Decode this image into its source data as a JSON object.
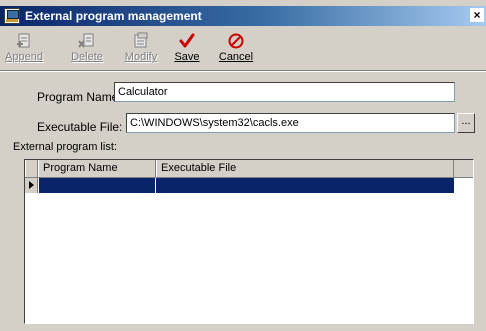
{
  "window": {
    "title": "External program management",
    "close_label": "×"
  },
  "toolbar": {
    "append_label": "Append",
    "delete_label": "Delete",
    "modify_label": "Modify",
    "save_label": "Save",
    "cancel_label": "Cancel"
  },
  "form": {
    "program_name_label": "Program Name:",
    "program_name_value": "Calculator",
    "executable_file_label": "Executable File:",
    "executable_file_value": "C:\\WINDOWS\\system32\\cacls.exe",
    "browse_label": "..."
  },
  "list": {
    "label": "External program list:",
    "columns": [
      "Program Name",
      "Executable File"
    ],
    "rows": [
      {
        "program_name": "",
        "executable_file": "",
        "selected": true
      }
    ]
  },
  "colors": {
    "title_bar": "#0a246a",
    "selection": "#0a246a",
    "save_icon": "#cc0000",
    "cancel_icon": "#cc0000"
  },
  "icons": {
    "append": "append-doc-icon",
    "delete": "delete-doc-icon",
    "modify": "modify-doc-icon",
    "save": "checkmark-icon",
    "cancel": "no-entry-icon"
  }
}
